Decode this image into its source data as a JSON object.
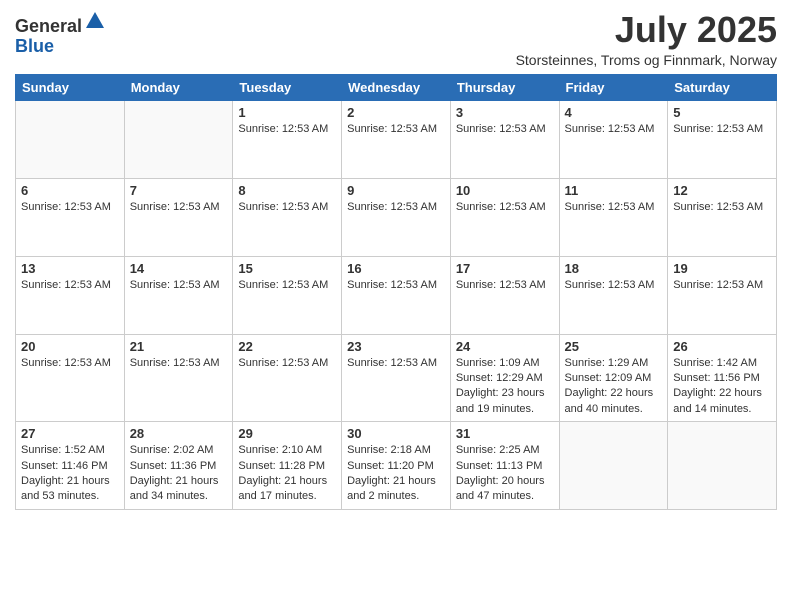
{
  "logo": {
    "general": "General",
    "blue": "Blue"
  },
  "title": "July 2025",
  "location": "Storsteinnes, Troms og Finnmark, Norway",
  "calendar": {
    "headers": [
      "Sunday",
      "Monday",
      "Tuesday",
      "Wednesday",
      "Thursday",
      "Friday",
      "Saturday"
    ],
    "weeks": [
      [
        {
          "day": "",
          "info": ""
        },
        {
          "day": "",
          "info": ""
        },
        {
          "day": "1",
          "info": "Sunrise: 12:53 AM"
        },
        {
          "day": "2",
          "info": "Sunrise: 12:53 AM"
        },
        {
          "day": "3",
          "info": "Sunrise: 12:53 AM"
        },
        {
          "day": "4",
          "info": "Sunrise: 12:53 AM"
        },
        {
          "day": "5",
          "info": "Sunrise: 12:53 AM"
        }
      ],
      [
        {
          "day": "6",
          "info": "Sunrise: 12:53 AM"
        },
        {
          "day": "7",
          "info": "Sunrise: 12:53 AM"
        },
        {
          "day": "8",
          "info": "Sunrise: 12:53 AM"
        },
        {
          "day": "9",
          "info": "Sunrise: 12:53 AM"
        },
        {
          "day": "10",
          "info": "Sunrise: 12:53 AM"
        },
        {
          "day": "11",
          "info": "Sunrise: 12:53 AM"
        },
        {
          "day": "12",
          "info": "Sunrise: 12:53 AM"
        }
      ],
      [
        {
          "day": "13",
          "info": "Sunrise: 12:53 AM"
        },
        {
          "day": "14",
          "info": "Sunrise: 12:53 AM"
        },
        {
          "day": "15",
          "info": "Sunrise: 12:53 AM"
        },
        {
          "day": "16",
          "info": "Sunrise: 12:53 AM"
        },
        {
          "day": "17",
          "info": "Sunrise: 12:53 AM"
        },
        {
          "day": "18",
          "info": "Sunrise: 12:53 AM"
        },
        {
          "day": "19",
          "info": "Sunrise: 12:53 AM"
        }
      ],
      [
        {
          "day": "20",
          "info": "Sunrise: 12:53 AM"
        },
        {
          "day": "21",
          "info": "Sunrise: 12:53 AM"
        },
        {
          "day": "22",
          "info": "Sunrise: 12:53 AM"
        },
        {
          "day": "23",
          "info": "Sunrise: 12:53 AM"
        },
        {
          "day": "24",
          "info": "Sunrise: 1:09 AM\nSunset: 12:29 AM\nDaylight: 23 hours and 19 minutes."
        },
        {
          "day": "25",
          "info": "Sunrise: 1:29 AM\nSunset: 12:09 AM\nDaylight: 22 hours and 40 minutes."
        },
        {
          "day": "26",
          "info": "Sunrise: 1:42 AM\nSunset: 11:56 PM\nDaylight: 22 hours and 14 minutes."
        }
      ],
      [
        {
          "day": "27",
          "info": "Sunrise: 1:52 AM\nSunset: 11:46 PM\nDaylight: 21 hours and 53 minutes."
        },
        {
          "day": "28",
          "info": "Sunrise: 2:02 AM\nSunset: 11:36 PM\nDaylight: 21 hours and 34 minutes."
        },
        {
          "day": "29",
          "info": "Sunrise: 2:10 AM\nSunset: 11:28 PM\nDaylight: 21 hours and 17 minutes."
        },
        {
          "day": "30",
          "info": "Sunrise: 2:18 AM\nSunset: 11:20 PM\nDaylight: 21 hours and 2 minutes."
        },
        {
          "day": "31",
          "info": "Sunrise: 2:25 AM\nSunset: 11:13 PM\nDaylight: 20 hours and 47 minutes."
        },
        {
          "day": "",
          "info": ""
        },
        {
          "day": "",
          "info": ""
        }
      ]
    ]
  }
}
